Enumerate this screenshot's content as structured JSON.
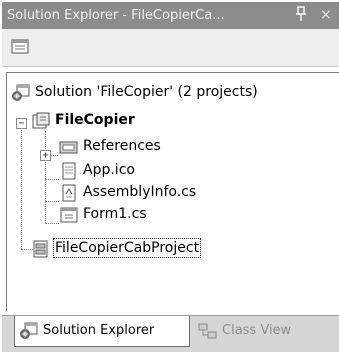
{
  "window": {
    "title": "Solution Explorer - FileCopierCa...",
    "pin_glyph": "Ͱ",
    "close_glyph": "×"
  },
  "toolbar": {
    "properties_icon": "properties-icon"
  },
  "tree": {
    "solution_label": "Solution 'FileCopier' (2 projects)",
    "project_label": "FileCopier",
    "items": [
      {
        "label": "References",
        "icon": "references-icon"
      },
      {
        "label": "App.ico",
        "icon": "file-icon"
      },
      {
        "label": "AssemblyInfo.cs",
        "icon": "cs-file-icon"
      },
      {
        "label": "Form1.cs",
        "icon": "form-icon"
      }
    ],
    "cab_project_label": "FileCopierCabProject",
    "expander_plus": "+",
    "expander_minus": "−"
  },
  "tabs": [
    {
      "label": "Solution Explorer",
      "active": true
    },
    {
      "label": "Class View",
      "active": false
    }
  ],
  "colors": {
    "titlebar": "#8c8c8c",
    "tab_strip": "#d6d6d6"
  }
}
